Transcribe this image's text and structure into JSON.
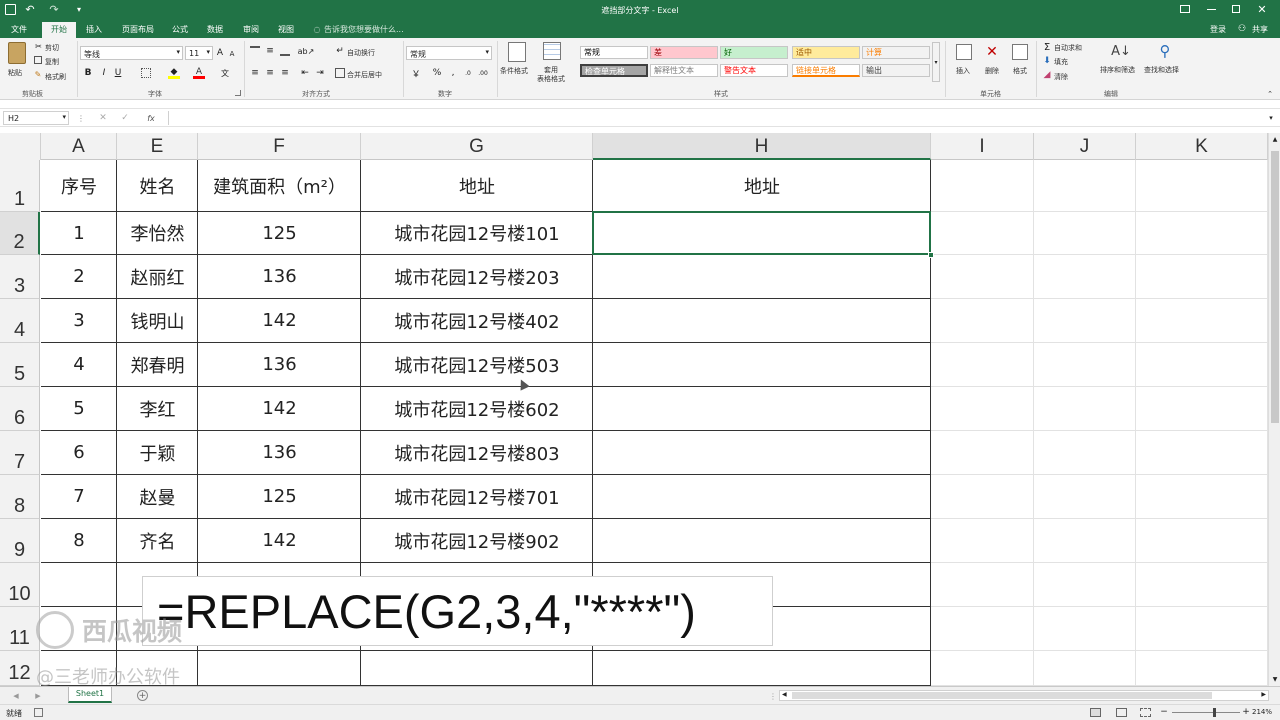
{
  "window": {
    "title": "遮挡部分文字 - Excel",
    "login": "登录",
    "share": "共享"
  },
  "tabs": [
    "文件",
    "开始",
    "插入",
    "页面布局",
    "公式",
    "数据",
    "审阅",
    "视图"
  ],
  "active_tab": "开始",
  "tellme": "告诉我您想要做什么...",
  "ribbon": {
    "clipboard": {
      "paste": "粘贴",
      "cut": "剪切",
      "copy": "复制",
      "format_painter": "格式刷",
      "label": "剪贴板"
    },
    "font": {
      "name": "等线",
      "size": "11",
      "bold": "B",
      "italic": "I",
      "underline": "U",
      "label": "字体"
    },
    "align": {
      "wrap": "自动换行",
      "merge": "合并后居中",
      "label": "对齐方式"
    },
    "number": {
      "format": "常规",
      "label": "数字"
    },
    "styles": {
      "cond": "条件格式",
      "table": "套用\n表格格式",
      "label": "样式",
      "cells": [
        {
          "text": "常规",
          "bg": "#ffffff",
          "fg": "#000000"
        },
        {
          "text": "差",
          "bg": "#ffc7ce",
          "fg": "#9c0006"
        },
        {
          "text": "好",
          "bg": "#c6efce",
          "fg": "#006100"
        },
        {
          "text": "适中",
          "bg": "#ffeb9c",
          "fg": "#9c5700"
        },
        {
          "text": "计算",
          "bg": "#f2f2f2",
          "fg": "#fa7d00"
        },
        {
          "text": "检查单元格",
          "bg": "#a5a5a5",
          "fg": "#ffffff"
        },
        {
          "text": "解释性文本",
          "bg": "#ffffff",
          "fg": "#7f7f7f"
        },
        {
          "text": "警告文本",
          "bg": "#ffffff",
          "fg": "#ff0000"
        },
        {
          "text": "链接单元格",
          "bg": "#ffffff",
          "fg": "#fa7d00"
        },
        {
          "text": "输出",
          "bg": "#f2f2f2",
          "fg": "#3f3f3f"
        }
      ]
    },
    "cells_grp": {
      "insert": "插入",
      "delete": "删除",
      "format": "格式",
      "label": "单元格"
    },
    "editing": {
      "autosum": "自动求和",
      "fill": "填充",
      "clear": "清除",
      "sort": "排序和筛选",
      "find": "查找和选择",
      "label": "编辑"
    }
  },
  "namebox": "H2",
  "fx": "fx",
  "columns": [
    "A",
    "E",
    "F",
    "G",
    "H",
    "I",
    "J",
    "K"
  ],
  "rows": [
    "1",
    "2",
    "3",
    "4",
    "5",
    "6",
    "7",
    "8",
    "9",
    "10",
    "11",
    "12"
  ],
  "table": {
    "headers": [
      "序号",
      "姓名",
      "建筑面积（m²）",
      "地址",
      "地址"
    ],
    "data": [
      [
        "1",
        "李怡然",
        "125",
        "城市花园12号楼101",
        ""
      ],
      [
        "2",
        "赵丽红",
        "136",
        "城市花园12号楼203",
        ""
      ],
      [
        "3",
        "钱明山",
        "142",
        "城市花园12号楼402",
        ""
      ],
      [
        "4",
        "郑春明",
        "136",
        "城市花园12号楼503",
        ""
      ],
      [
        "5",
        "李红",
        "142",
        "城市花园12号楼602",
        ""
      ],
      [
        "6",
        "于颖",
        "136",
        "城市花园12号楼803",
        ""
      ],
      [
        "7",
        "赵曼",
        "125",
        "城市花园12号楼701",
        ""
      ],
      [
        "8",
        "齐名",
        "142",
        "城市花园12号楼902",
        ""
      ]
    ]
  },
  "formula_overlay": "=REPLACE(G2,3,4,\"****\")",
  "watermark": {
    "brand": "西瓜视频",
    "author": "@三老师办公软件"
  },
  "sheet_tab": "Sheet1",
  "status": {
    "ready": "就绪",
    "zoom": "214%"
  }
}
